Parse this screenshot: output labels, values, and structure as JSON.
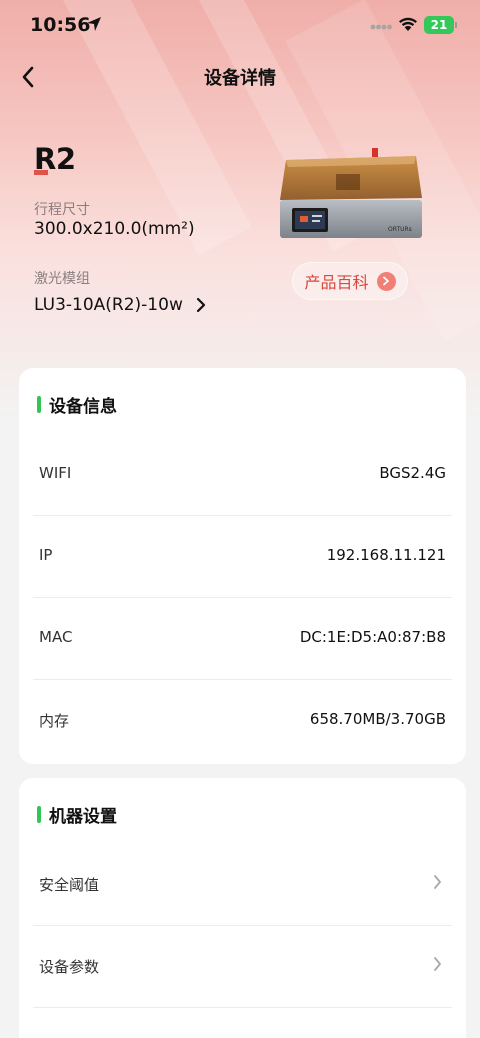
{
  "status_bar": {
    "time": "10:56",
    "battery": "21"
  },
  "nav": {
    "title": "设备详情"
  },
  "device": {
    "model": "R2",
    "travel_size_label": "行程尺寸",
    "travel_size_value": "300.0x210.0(mm²)",
    "laser_module_label": "激光模组",
    "laser_module_value": "LU3-10A(R2)-10w",
    "wiki_button_label": "产品百科",
    "printer_brand": "ORTURs"
  },
  "device_info": {
    "title": "设备信息",
    "rows": [
      {
        "label": "WIFI",
        "value": "BGS2.4G"
      },
      {
        "label": "IP",
        "value": "192.168.11.121"
      },
      {
        "label": "MAC",
        "value": "DC:1E:D5:A0:87:B8"
      },
      {
        "label": "内存",
        "value": "658.70MB/3.70GB"
      }
    ]
  },
  "machine_settings": {
    "title": "机器设置",
    "rows": [
      {
        "label": "安全阈值"
      },
      {
        "label": "设备参数"
      }
    ]
  },
  "colors": {
    "accent_green": "#31c553",
    "accent_red": "#d8473d",
    "battery_green": "#34c759"
  }
}
